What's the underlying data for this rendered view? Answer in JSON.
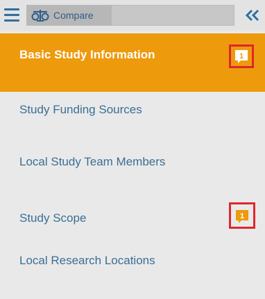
{
  "toolbar": {
    "compare_label": "Compare",
    "menu_icon": "hamburger-menu-icon",
    "compare_icon": "balance-scale-icon",
    "collapse_icon": "double-chevron-left-icon"
  },
  "nav": {
    "items": [
      {
        "label": "Basic Study Information",
        "active": true,
        "badge": "1"
      },
      {
        "label": "Study Funding Sources",
        "active": false
      },
      {
        "label": "Local Study Team Members",
        "active": false
      },
      {
        "label": "Study Scope",
        "active": false,
        "badge": "1"
      },
      {
        "label": "Local Research Locations",
        "active": false
      }
    ]
  },
  "colors": {
    "active_background": "#ee9a0d",
    "link_text": "#3a6f95",
    "highlight_border": "#e0262d",
    "badge_orange": "#ee9a0d"
  }
}
